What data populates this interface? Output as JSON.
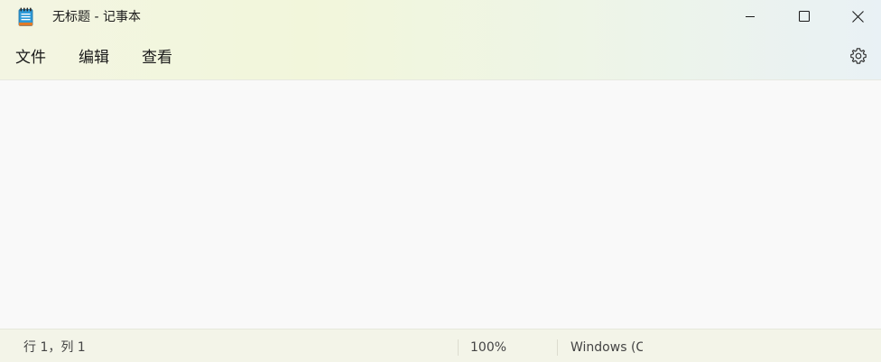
{
  "window": {
    "title": "无标题 - 记事本"
  },
  "menu": {
    "file": "文件",
    "edit": "编辑",
    "view": "查看"
  },
  "editor": {
    "content": ""
  },
  "status": {
    "position": "行 1，列 1",
    "zoom": "100%",
    "encoding": "Windows (CRLF)"
  },
  "icons": {
    "app": "notepad-icon",
    "minimize": "minimize-icon",
    "maximize": "maximize-icon",
    "close": "close-icon",
    "settings": "gear-icon"
  },
  "colors": {
    "icon_blue": "#2e9ad8",
    "icon_orange": "#e07a28"
  }
}
